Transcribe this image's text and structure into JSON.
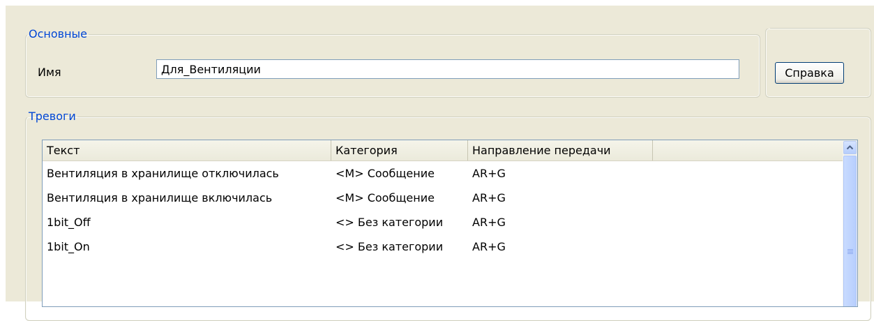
{
  "general_group": {
    "legend": "Основные",
    "name_label": "Имя",
    "name_value": "Для_Вентиляции"
  },
  "help_button": {
    "label": "Справка"
  },
  "alarms_group": {
    "legend": "Тревоги",
    "columns": [
      "Текст",
      "Категория",
      "Направление передачи"
    ],
    "rows": [
      {
        "text": "Вентиляция в хранилище отключилась",
        "category": "<M> Сообщение",
        "direction": "AR+G"
      },
      {
        "text": "Вентиляция в хранилище включилась",
        "category": "<M> Сообщение",
        "direction": "AR+G"
      },
      {
        "text": "1bit_Off",
        "category": "<> Без категории",
        "direction": "AR+G"
      },
      {
        "text": "1bit_On",
        "category": "<> Без категории",
        "direction": "AR+G"
      }
    ]
  },
  "icons": {
    "scroll_up": "chevron-up-icon",
    "scroll_grip": "grip-icon"
  },
  "colors": {
    "legend_text": "#0046d5",
    "dialog_bg": "#ece9d8",
    "field_border": "#7f9db9"
  }
}
